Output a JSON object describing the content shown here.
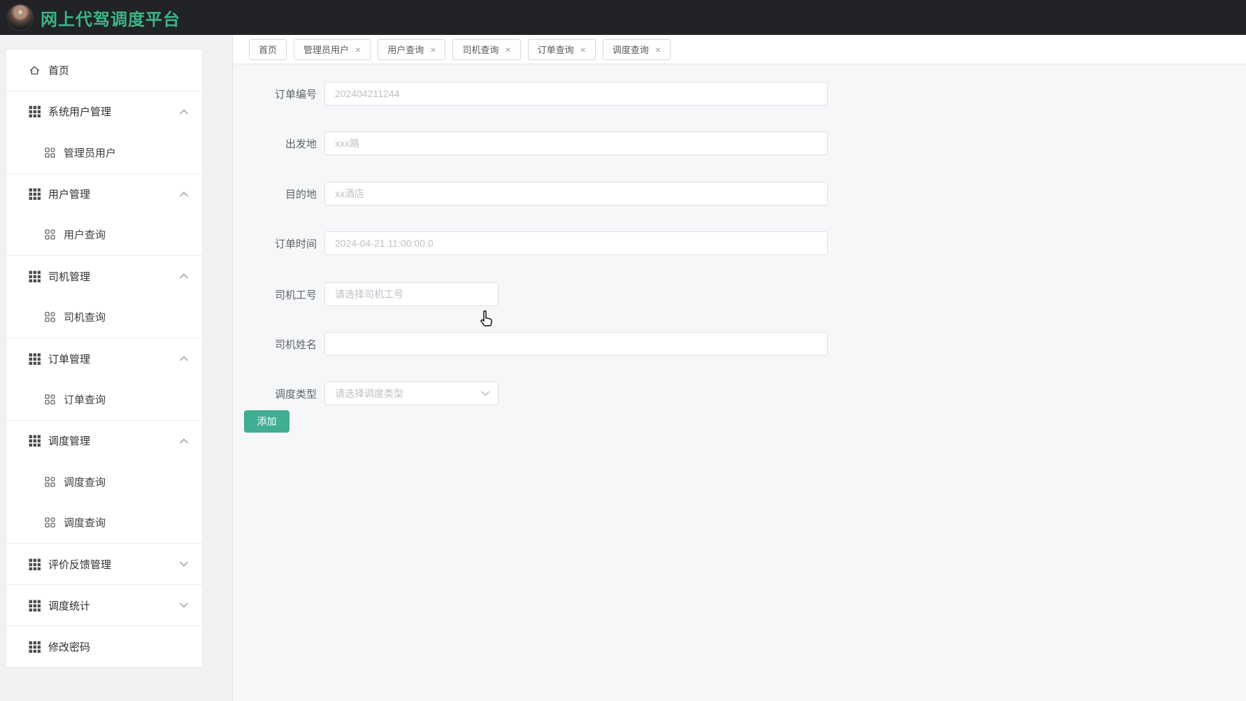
{
  "header": {
    "title": "网上代驾调度平台"
  },
  "colors": {
    "header_bg": "#212326",
    "brand_green": "#3eb487",
    "button_green": "#40ae93",
    "panel_bg": "#f6f7f8",
    "page_bg": "#f0f1f2",
    "input_border": "#dde0e5",
    "placeholder": "#bcc0c6"
  },
  "sidebar": {
    "items": [
      {
        "key": "home",
        "label": "首页",
        "type": "home",
        "chevron": "none"
      },
      {
        "key": "system-user-mgmt",
        "label": "系统用户管理",
        "type": "group",
        "chevron": "up"
      },
      {
        "key": "admin-users",
        "label": "管理员用户",
        "type": "sub",
        "chevron": "none"
      },
      {
        "key": "user-mgmt",
        "label": "用户管理",
        "type": "group",
        "chevron": "up"
      },
      {
        "key": "user-query",
        "label": "用户查询",
        "type": "sub",
        "chevron": "none"
      },
      {
        "key": "driver-mgmt",
        "label": "司机管理",
        "type": "group",
        "chevron": "up"
      },
      {
        "key": "driver-query",
        "label": "司机查询",
        "type": "sub",
        "chevron": "none"
      },
      {
        "key": "order-mgmt",
        "label": "订单管理",
        "type": "group",
        "chevron": "up"
      },
      {
        "key": "order-query",
        "label": "订单查询",
        "type": "sub",
        "chevron": "none"
      },
      {
        "key": "dispatch-mgmt",
        "label": "调度管理",
        "type": "group",
        "chevron": "up"
      },
      {
        "key": "dispatch-query",
        "label": "调度查询",
        "type": "sub",
        "chevron": "none"
      },
      {
        "key": "dispatch-query-2",
        "label": "调度查询",
        "type": "sub",
        "chevron": "none"
      },
      {
        "key": "feedback-mgmt",
        "label": "评价反馈管理",
        "type": "group",
        "chevron": "down"
      },
      {
        "key": "dispatch-stats",
        "label": "调度统计",
        "type": "group",
        "chevron": "down"
      },
      {
        "key": "change-password",
        "label": "修改密码",
        "type": "group",
        "chevron": "none"
      }
    ]
  },
  "tabs": [
    {
      "key": "home",
      "label": "首页",
      "closable": false
    },
    {
      "key": "admin-users",
      "label": "管理员用户",
      "closable": true
    },
    {
      "key": "user-query",
      "label": "用户查询",
      "closable": true
    },
    {
      "key": "driver-query",
      "label": "司机查询",
      "closable": true
    },
    {
      "key": "order-query",
      "label": "订单查询",
      "closable": true
    },
    {
      "key": "dispatch-query",
      "label": "调度查询",
      "closable": true
    }
  ],
  "close_glyph": "×",
  "form": {
    "fields": [
      {
        "key": "order-no",
        "label": "订单编号",
        "placeholder": "202404211244",
        "width": "full",
        "kind": "input"
      },
      {
        "key": "origin",
        "label": "出发地",
        "placeholder": "xxx路",
        "width": "full",
        "kind": "input"
      },
      {
        "key": "destination",
        "label": "目的地",
        "placeholder": "xx酒店",
        "width": "full",
        "kind": "input"
      },
      {
        "key": "order-time",
        "label": "订单时间",
        "placeholder": "2024-04-21 11:00:00.0",
        "width": "full",
        "kind": "input"
      },
      {
        "key": "driver-id",
        "label": "司机工号",
        "placeholder": "请选择司机工号",
        "width": "narrow",
        "kind": "select-plain"
      },
      {
        "key": "driver-name",
        "label": "司机姓名",
        "placeholder": "",
        "width": "full",
        "kind": "input"
      },
      {
        "key": "dispatch-type",
        "label": "调度类型",
        "placeholder": "请选择调度类型",
        "width": "narrow",
        "kind": "select"
      }
    ],
    "submit_label": "添加"
  }
}
